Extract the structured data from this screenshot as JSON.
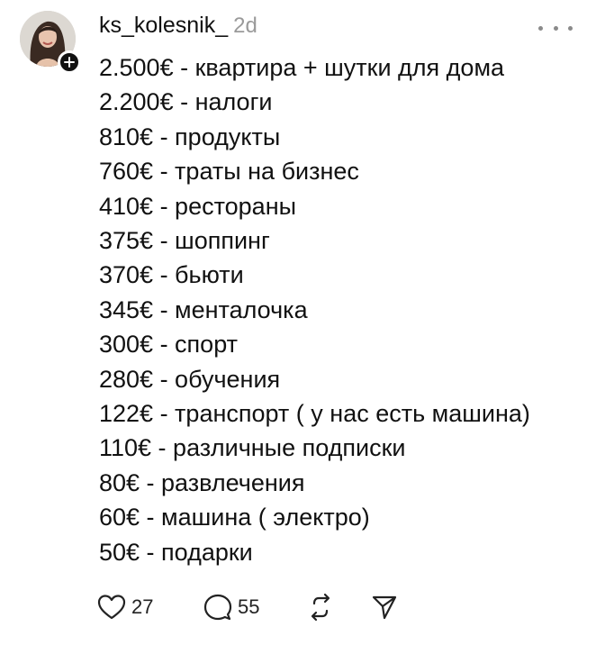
{
  "post": {
    "username": "ks_kolesnik_",
    "time": "2d",
    "lines": [
      "2.500€ - квартира + шутки для дома",
      "2.200€ - налоги",
      "810€ - продукты",
      "760€ - траты на бизнес",
      "410€ - рестораны",
      "375€ - шоппинг",
      "370€ - бьюти",
      "345€ - менталочка",
      "300€ - спорт",
      "280€ - обучения",
      "122€ - транспорт ( у нас есть машина)",
      "110€ - различные подписки",
      "80€ - развлечения",
      "60€ - машина ( электро)",
      "50€ - подарки"
    ]
  },
  "actions": {
    "likes": "27",
    "comments": "55"
  },
  "icons": {
    "follow": "plus-icon",
    "more": "more-horizontal-icon",
    "like": "heart-icon",
    "comment": "comment-bubble-icon",
    "repost": "repost-icon",
    "share": "send-icon"
  },
  "colors": {
    "text": "#111111",
    "muted": "#9a9a9a",
    "background": "#ffffff"
  }
}
